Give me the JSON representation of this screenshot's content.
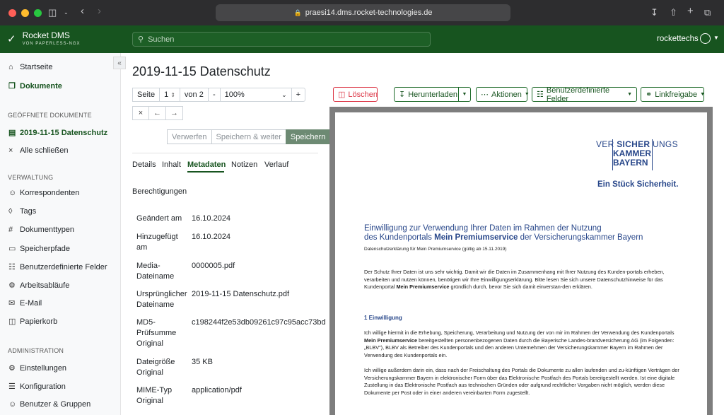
{
  "browser": {
    "url": "praesi14.dms.rocket-technologies.de"
  },
  "app": {
    "name": "Rocket DMS",
    "subtitle": "VON PAPERLESS-NGX",
    "search_placeholder": "Suchen",
    "user": "rockettechs"
  },
  "sidebar": {
    "home": "Startseite",
    "documents": "Dokumente",
    "open_docs_header": "GEÖFFNETE DOKUMENTE",
    "open_doc": "2019-11-15 Datenschutz",
    "close_all": "Alle schließen",
    "admin_header": "VERWALTUNG",
    "manage_items": [
      "Korrespondenten",
      "Tags",
      "Dokumenttypen",
      "Speicherpfade",
      "Benutzerdefinierte Felder",
      "Arbeitsabläufe",
      "E-Mail",
      "Papierkorb"
    ],
    "administration_header": "ADMINISTRATION",
    "admin_items": [
      "Einstellungen",
      "Konfiguration",
      "Benutzer & Gruppen"
    ]
  },
  "document": {
    "title": "2019-11-15 Datenschutz",
    "page_label": "Seite",
    "page_value": "1",
    "page_total": "von 2",
    "zoom_minus": "-",
    "zoom_value": "100%",
    "zoom_plus": "+",
    "discard": "Verwerfen",
    "save_next": "Speichern & weiter",
    "save": "Speichern"
  },
  "tabs": [
    "Details",
    "Inhalt",
    "Metadaten",
    "Notizen",
    "Verlauf"
  ],
  "metadata": {
    "permissions": "Berechtigungen",
    "rows": [
      {
        "k": "Geändert am",
        "v": "16.10.2024"
      },
      {
        "k": "Hinzugefügt am",
        "v": "16.10.2024"
      },
      {
        "k": "Media-Dateiname",
        "v": "0000005.pdf"
      },
      {
        "k": "Ursprünglicher Dateiname",
        "v": "2019-11-15 Datenschutz.pdf"
      },
      {
        "k": "MD5-Prüfsumme Original",
        "v": "c198244f2e53db09261c97c95acc73bd"
      },
      {
        "k": "Dateigröße Original",
        "v": "35 KB"
      },
      {
        "k": "MIME-Typ Original",
        "v": "application/pdf"
      }
    ]
  },
  "toolbar": {
    "delete": "Löschen",
    "download": "Herunterladen",
    "actions": "Aktionen",
    "custom_fields": "Benutzerdefinierte Felder",
    "share": "Linkfreigabe"
  },
  "pdf": {
    "logo_ver": "VER",
    "logo_sicher": "SICHER",
    "logo_ungs": "UNGS",
    "logo_kammer": "KAMMER",
    "logo_bayern": "BAYERN",
    "slogan": "Ein Stück Sicherheit.",
    "heading1": "Einwilligung zur Verwendung Ihrer Daten im Rahmen der Nutzung",
    "heading2_a": "des Kundenportals ",
    "heading2_b": "Mein Premiumservice",
    "heading2_c": " der Versicherungskammer Bayern",
    "small": "Datenschutzerklärung für Mein Premiumservice (gültig ab 15.11.2019)",
    "p1_a": "Der Schutz Ihrer Daten ist uns sehr wichtig. Damit wir die Daten im Zusammenhang mit Ihrer Nutzung des Kunden-portals erheben, verarbeiten und nutzen können, benötigen wir Ihre Einwilligungserklärung. Bitte lesen Sie sich unsere Datenschutzhinweise für das Kundenportal ",
    "p1_b": "Mein Premiumservice",
    "p1_c": " gründlich durch, bevor Sie sich damit einverstan-den erklären.",
    "section": "1      Einwilligung",
    "p2_a": "Ich willige hiermit in die Erhebung, Speicherung, Verarbeitung und Nutzung der von mir im Rahmen der Verwendung des Kundenportals ",
    "p2_b": "Mein Premiumservice",
    "p2_c": " bereitgestellten personenbezogenen Daten durch die Bayerische Landes-brandversicherung AG (im Folgenden: „BLBV\"), BLBV als Betreiber des Kundenportals und den anderen Unternehmen der Versicherungskammer Bayern im Rahmen der Verwendung des Kundenportals ein.",
    "p3": "Ich willige außerdem darin ein, dass nach der Freischaltung des Portals die Dokumente zu allen laufenden und zu-künftigen Verträgen der Versicherungskammer Bayern in elektronischer Form über das Elektronische Postfach des Portals bereitgestellt werden. Ist eine digitale Zustellung in das Elektronische Postfach aus technischen Gründen oder aufgrund rechtlicher Vorgaben nicht möglich, werden diese Dokumente per Post oder in einer anderen vereinbarten Form zugestellt."
  }
}
